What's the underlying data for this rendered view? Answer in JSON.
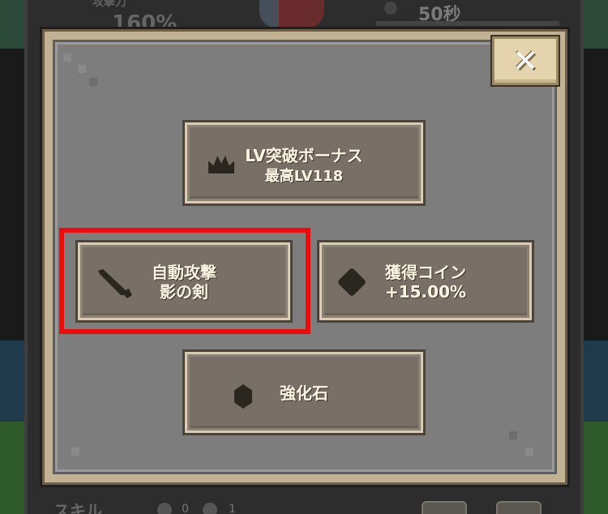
{
  "background": {
    "stat_label": "攻撃力",
    "stat_value": "160%",
    "timer_value": "50秒",
    "skill_title": "スキル",
    "coin_count_a": "0",
    "coin_count_b": "1"
  },
  "modal": {
    "close_label": "✕",
    "options": {
      "lv_bonus": {
        "line1": "LV突破ボーナス",
        "line2": "最高LV118",
        "icon": "crown-icon"
      },
      "auto_attack": {
        "line1": "自動攻撃",
        "line2": "影の剣",
        "icon": "sword-icon"
      },
      "coin_bonus": {
        "line1": "獲得コイン",
        "line2": "+15.00%",
        "icon": "diamond-icon"
      },
      "stone": {
        "line1": "強化石",
        "icon": "stone-icon"
      }
    }
  },
  "colors": {
    "highlight": "#ee0b0b",
    "modal_frame": "#c2b294",
    "modal_inner": "#7d7d7d",
    "button_face": "#787066",
    "text": "#fdf6e3"
  }
}
